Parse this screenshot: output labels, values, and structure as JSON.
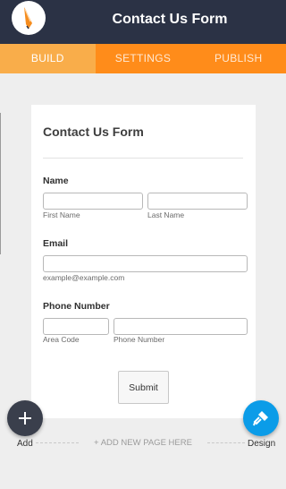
{
  "header": {
    "title": "Contact Us Form"
  },
  "tabs": [
    {
      "label": "BUILD",
      "active": true
    },
    {
      "label": "SETTINGS",
      "active": false
    },
    {
      "label": "PUBLISH",
      "active": false
    }
  ],
  "form": {
    "title": "Contact Us Form",
    "name": {
      "label": "Name",
      "first_sublabel": "First Name",
      "last_sublabel": "Last Name",
      "first_value": "",
      "last_value": ""
    },
    "email": {
      "label": "Email",
      "sublabel": "example@example.com",
      "value": ""
    },
    "phone": {
      "label": "Phone Number",
      "area_sublabel": "Area Code",
      "number_sublabel": "Phone Number",
      "area_value": "",
      "number_value": ""
    },
    "submit_label": "Submit"
  },
  "footer": {
    "add_label": "Add",
    "add_page_label": "+ ADD NEW PAGE HERE",
    "design_label": "Design"
  },
  "icons": {
    "logo": "pencil-logo-icon",
    "add": "plus-icon",
    "design": "paint-roller-icon"
  },
  "colors": {
    "topbar": "#2b3245",
    "tabs": "#ff8c1a",
    "tab_active": "#f9ad4a",
    "design_fab": "#0b9ce8",
    "add_fab": "#3a3f4c"
  }
}
